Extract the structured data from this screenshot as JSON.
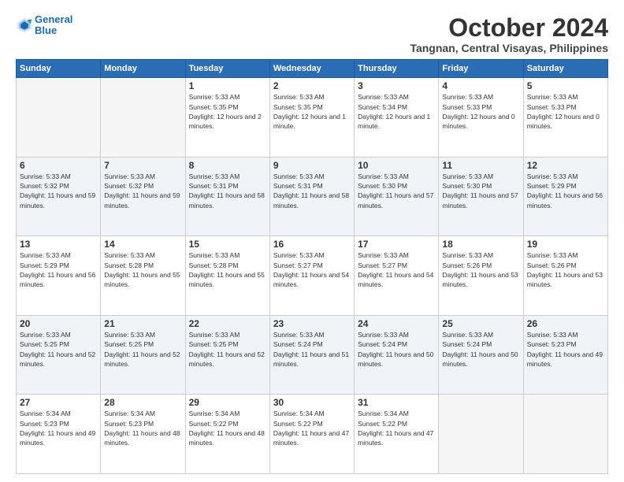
{
  "header": {
    "logo_line1": "General",
    "logo_line2": "Blue",
    "month": "October 2024",
    "location": "Tangnan, Central Visayas, Philippines"
  },
  "weekdays": [
    "Sunday",
    "Monday",
    "Tuesday",
    "Wednesday",
    "Thursday",
    "Friday",
    "Saturday"
  ],
  "weeks": [
    [
      {
        "day": "",
        "sunrise": "",
        "sunset": "",
        "daylight": ""
      },
      {
        "day": "",
        "sunrise": "",
        "sunset": "",
        "daylight": ""
      },
      {
        "day": "1",
        "sunrise": "Sunrise: 5:33 AM",
        "sunset": "Sunset: 5:35 PM",
        "daylight": "Daylight: 12 hours and 2 minutes."
      },
      {
        "day": "2",
        "sunrise": "Sunrise: 5:33 AM",
        "sunset": "Sunset: 5:35 PM",
        "daylight": "Daylight: 12 hours and 1 minute."
      },
      {
        "day": "3",
        "sunrise": "Sunrise: 5:33 AM",
        "sunset": "Sunset: 5:34 PM",
        "daylight": "Daylight: 12 hours and 1 minute."
      },
      {
        "day": "4",
        "sunrise": "Sunrise: 5:33 AM",
        "sunset": "Sunset: 5:33 PM",
        "daylight": "Daylight: 12 hours and 0 minutes."
      },
      {
        "day": "5",
        "sunrise": "Sunrise: 5:33 AM",
        "sunset": "Sunset: 5:33 PM",
        "daylight": "Daylight: 12 hours and 0 minutes."
      }
    ],
    [
      {
        "day": "6",
        "sunrise": "Sunrise: 5:33 AM",
        "sunset": "Sunset: 5:32 PM",
        "daylight": "Daylight: 11 hours and 59 minutes."
      },
      {
        "day": "7",
        "sunrise": "Sunrise: 5:33 AM",
        "sunset": "Sunset: 5:32 PM",
        "daylight": "Daylight: 11 hours and 59 minutes."
      },
      {
        "day": "8",
        "sunrise": "Sunrise: 5:33 AM",
        "sunset": "Sunset: 5:31 PM",
        "daylight": "Daylight: 11 hours and 58 minutes."
      },
      {
        "day": "9",
        "sunrise": "Sunrise: 5:33 AM",
        "sunset": "Sunset: 5:31 PM",
        "daylight": "Daylight: 11 hours and 58 minutes."
      },
      {
        "day": "10",
        "sunrise": "Sunrise: 5:33 AM",
        "sunset": "Sunset: 5:30 PM",
        "daylight": "Daylight: 11 hours and 57 minutes."
      },
      {
        "day": "11",
        "sunrise": "Sunrise: 5:33 AM",
        "sunset": "Sunset: 5:30 PM",
        "daylight": "Daylight: 11 hours and 57 minutes."
      },
      {
        "day": "12",
        "sunrise": "Sunrise: 5:33 AM",
        "sunset": "Sunset: 5:29 PM",
        "daylight": "Daylight: 11 hours and 56 minutes."
      }
    ],
    [
      {
        "day": "13",
        "sunrise": "Sunrise: 5:33 AM",
        "sunset": "Sunset: 5:29 PM",
        "daylight": "Daylight: 11 hours and 56 minutes."
      },
      {
        "day": "14",
        "sunrise": "Sunrise: 5:33 AM",
        "sunset": "Sunset: 5:28 PM",
        "daylight": "Daylight: 11 hours and 55 minutes."
      },
      {
        "day": "15",
        "sunrise": "Sunrise: 5:33 AM",
        "sunset": "Sunset: 5:28 PM",
        "daylight": "Daylight: 11 hours and 55 minutes."
      },
      {
        "day": "16",
        "sunrise": "Sunrise: 5:33 AM",
        "sunset": "Sunset: 5:27 PM",
        "daylight": "Daylight: 11 hours and 54 minutes."
      },
      {
        "day": "17",
        "sunrise": "Sunrise: 5:33 AM",
        "sunset": "Sunset: 5:27 PM",
        "daylight": "Daylight: 11 hours and 54 minutes."
      },
      {
        "day": "18",
        "sunrise": "Sunrise: 5:33 AM",
        "sunset": "Sunset: 5:26 PM",
        "daylight": "Daylight: 11 hours and 53 minutes."
      },
      {
        "day": "19",
        "sunrise": "Sunrise: 5:33 AM",
        "sunset": "Sunset: 5:26 PM",
        "daylight": "Daylight: 11 hours and 53 minutes."
      }
    ],
    [
      {
        "day": "20",
        "sunrise": "Sunrise: 5:33 AM",
        "sunset": "Sunset: 5:25 PM",
        "daylight": "Daylight: 11 hours and 52 minutes."
      },
      {
        "day": "21",
        "sunrise": "Sunrise: 5:33 AM",
        "sunset": "Sunset: 5:25 PM",
        "daylight": "Daylight: 11 hours and 52 minutes."
      },
      {
        "day": "22",
        "sunrise": "Sunrise: 5:33 AM",
        "sunset": "Sunset: 5:25 PM",
        "daylight": "Daylight: 11 hours and 52 minutes."
      },
      {
        "day": "23",
        "sunrise": "Sunrise: 5:33 AM",
        "sunset": "Sunset: 5:24 PM",
        "daylight": "Daylight: 11 hours and 51 minutes."
      },
      {
        "day": "24",
        "sunrise": "Sunrise: 5:33 AM",
        "sunset": "Sunset: 5:24 PM",
        "daylight": "Daylight: 11 hours and 50 minutes."
      },
      {
        "day": "25",
        "sunrise": "Sunrise: 5:33 AM",
        "sunset": "Sunset: 5:24 PM",
        "daylight": "Daylight: 11 hours and 50 minutes."
      },
      {
        "day": "26",
        "sunrise": "Sunrise: 5:33 AM",
        "sunset": "Sunset: 5:23 PM",
        "daylight": "Daylight: 11 hours and 49 minutes."
      }
    ],
    [
      {
        "day": "27",
        "sunrise": "Sunrise: 5:34 AM",
        "sunset": "Sunset: 5:23 PM",
        "daylight": "Daylight: 11 hours and 49 minutes."
      },
      {
        "day": "28",
        "sunrise": "Sunrise: 5:34 AM",
        "sunset": "Sunset: 5:23 PM",
        "daylight": "Daylight: 11 hours and 48 minutes."
      },
      {
        "day": "29",
        "sunrise": "Sunrise: 5:34 AM",
        "sunset": "Sunset: 5:22 PM",
        "daylight": "Daylight: 11 hours and 48 minutes."
      },
      {
        "day": "30",
        "sunrise": "Sunrise: 5:34 AM",
        "sunset": "Sunset: 5:22 PM",
        "daylight": "Daylight: 11 hours and 47 minutes."
      },
      {
        "day": "31",
        "sunrise": "Sunrise: 5:34 AM",
        "sunset": "Sunset: 5:22 PM",
        "daylight": "Daylight: 11 hours and 47 minutes."
      },
      {
        "day": "",
        "sunrise": "",
        "sunset": "",
        "daylight": ""
      },
      {
        "day": "",
        "sunrise": "",
        "sunset": "",
        "daylight": ""
      }
    ]
  ]
}
